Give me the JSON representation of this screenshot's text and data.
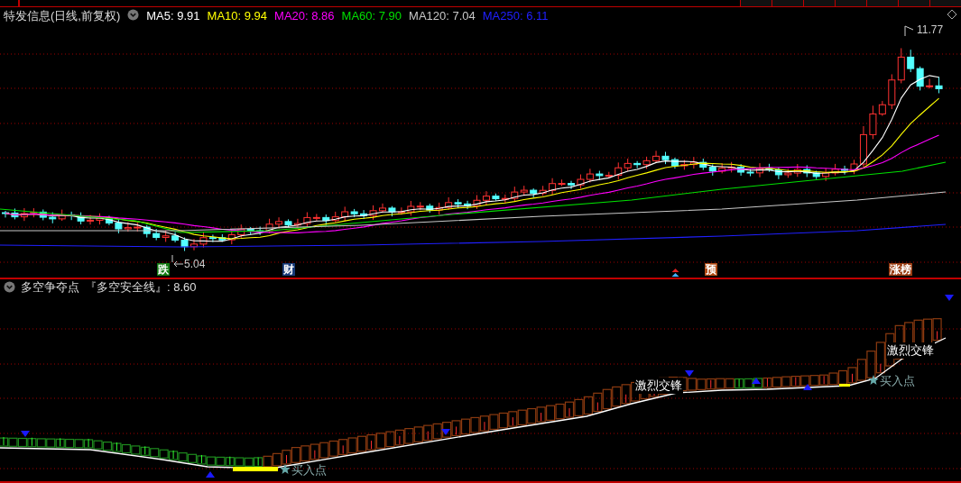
{
  "main_panel": {
    "title": "特发信息(日线,前复权)",
    "indicators": [
      {
        "label": "MA5: 9.91",
        "color": "#ffffff"
      },
      {
        "label": "MA10: 9.94",
        "color": "#ffff00"
      },
      {
        "label": "MA20: 8.86",
        "color": "#ff00ff"
      },
      {
        "label": "MA60: 7.90",
        "color": "#00e000"
      },
      {
        "label": "MA120: 7.04",
        "color": "#c8c8c8"
      },
      {
        "label": "MA250: 6.11",
        "color": "#2020ff"
      }
    ],
    "high_label": "11.77",
    "low_label": "5.04",
    "markers": [
      {
        "text": "跌",
        "color": "#117a11"
      },
      {
        "text": "财",
        "color": "#163a78"
      },
      {
        "text": "预",
        "color": "#b04a14"
      },
      {
        "text": "涨榜",
        "color": "#9a3c12"
      }
    ]
  },
  "sub_panel": {
    "title": "多空争夺点",
    "subtitle": "『多空安全线』: 8.60",
    "annotations": [
      "激烈交锋",
      "激烈交锋"
    ],
    "buy_labels": [
      "买入点",
      "买入点"
    ]
  }
}
